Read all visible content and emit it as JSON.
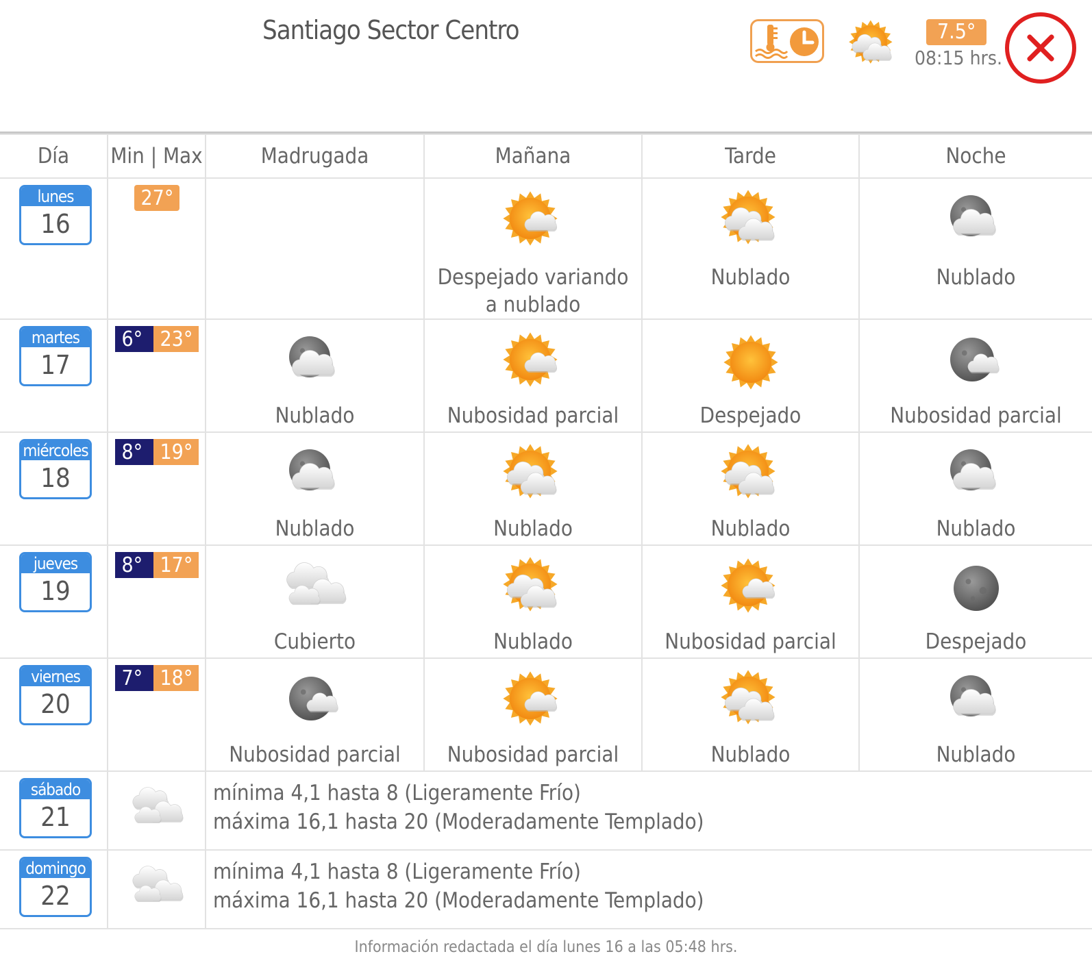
{
  "header": {
    "title": "Santiago Sector Centro",
    "current_temp": "7.5°",
    "current_time": "08:15 hrs.",
    "badge_icon": "thermometer-clock-icon",
    "current_weather_icon": "partly-cloudy-sun-icon",
    "close_icon": "close-icon"
  },
  "columns": [
    "Día",
    "Min | Max",
    "Madrugada",
    "Mañana",
    "Tarde",
    "Noche"
  ],
  "days": [
    {
      "name": "lunes",
      "date": "16",
      "min": "",
      "max": "27°",
      "periods": [
        null,
        {
          "icon": "sun-cloud",
          "label": "Despejado variando a nublado"
        },
        {
          "icon": "sun-clouds",
          "label": "Nublado"
        },
        {
          "icon": "moon-clouds",
          "label": "Nublado"
        }
      ]
    },
    {
      "name": "martes",
      "date": "17",
      "min": "6°",
      "max": "23°",
      "periods": [
        {
          "icon": "moon-clouds",
          "label": "Nublado"
        },
        {
          "icon": "sun-cloud",
          "label": "Nubosidad parcial"
        },
        {
          "icon": "sun",
          "label": "Despejado"
        },
        {
          "icon": "moon-cloud",
          "label": "Nubosidad parcial"
        }
      ]
    },
    {
      "name": "miércoles",
      "date": "18",
      "min": "8°",
      "max": "19°",
      "periods": [
        {
          "icon": "moon-clouds",
          "label": "Nublado"
        },
        {
          "icon": "sun-clouds",
          "label": "Nublado"
        },
        {
          "icon": "sun-clouds",
          "label": "Nublado"
        },
        {
          "icon": "moon-clouds",
          "label": "Nublado"
        }
      ]
    },
    {
      "name": "jueves",
      "date": "19",
      "min": "8°",
      "max": "17°",
      "periods": [
        {
          "icon": "overcast",
          "label": "Cubierto"
        },
        {
          "icon": "sun-clouds",
          "label": "Nublado"
        },
        {
          "icon": "sun-cloud",
          "label": "Nubosidad parcial"
        },
        {
          "icon": "moon",
          "label": "Despejado"
        }
      ]
    },
    {
      "name": "viernes",
      "date": "20",
      "min": "7°",
      "max": "18°",
      "periods": [
        {
          "icon": "moon-cloud",
          "label": "Nubosidad parcial"
        },
        {
          "icon": "sun-cloud",
          "label": "Nubosidad parcial"
        },
        {
          "icon": "sun-clouds",
          "label": "Nublado"
        },
        {
          "icon": "moon-clouds",
          "label": "Nublado"
        }
      ]
    }
  ],
  "weekend": [
    {
      "name": "sábado",
      "date": "21",
      "icon": "overcast",
      "line1": "mínima 4,1 hasta 8 (Ligeramente Frío)",
      "line2": "máxima 16,1 hasta 20 (Moderadamente Templado)"
    },
    {
      "name": "domingo",
      "date": "22",
      "icon": "overcast",
      "line1": "mínima 4,1 hasta 8 (Ligeramente Frío)",
      "line2": "máxima 16,1 hasta 20 (Moderadamente Templado)"
    }
  ],
  "footer": "Información redactada el día lunes 16 a las 05:48 hrs.",
  "colors": {
    "accent_blue": "#3d8de0",
    "min_bg": "#1d1d6e",
    "max_bg": "#f2a254",
    "close_red": "#e02020"
  }
}
